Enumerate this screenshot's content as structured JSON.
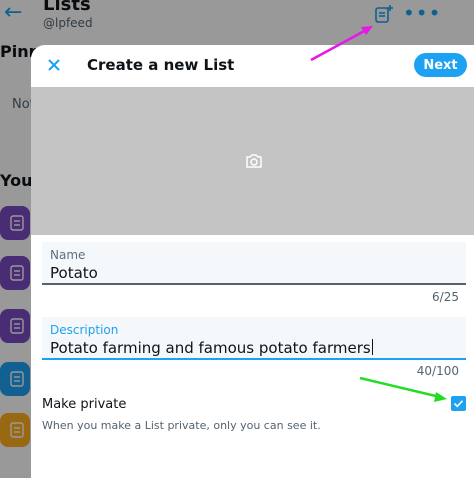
{
  "background": {
    "title": "Lists",
    "handle": "@lpfeed",
    "pinned_heading": "Pinn",
    "pinned_empty_text": "Not",
    "your_lists_heading": "Your",
    "list_thumb_colors": [
      "#794bc4",
      "#794bc4",
      "#794bc4",
      "#1da1f2",
      "#ffad1f"
    ]
  },
  "modal": {
    "title": "Create a new List",
    "next_label": "Next",
    "name_field": {
      "label": "Name",
      "value": "Potato",
      "counter": "6/25"
    },
    "description_field": {
      "label": "Description",
      "value": "Potato farming and famous potato farmers",
      "counter": "40/100"
    },
    "make_private_label": "Make private",
    "make_private_checked": true,
    "private_note": "When you make a List private, only you can see it."
  },
  "colors": {
    "accent": "#1da1f2",
    "arrow_magenta": "#e619e6",
    "arrow_green": "#22dd22"
  }
}
